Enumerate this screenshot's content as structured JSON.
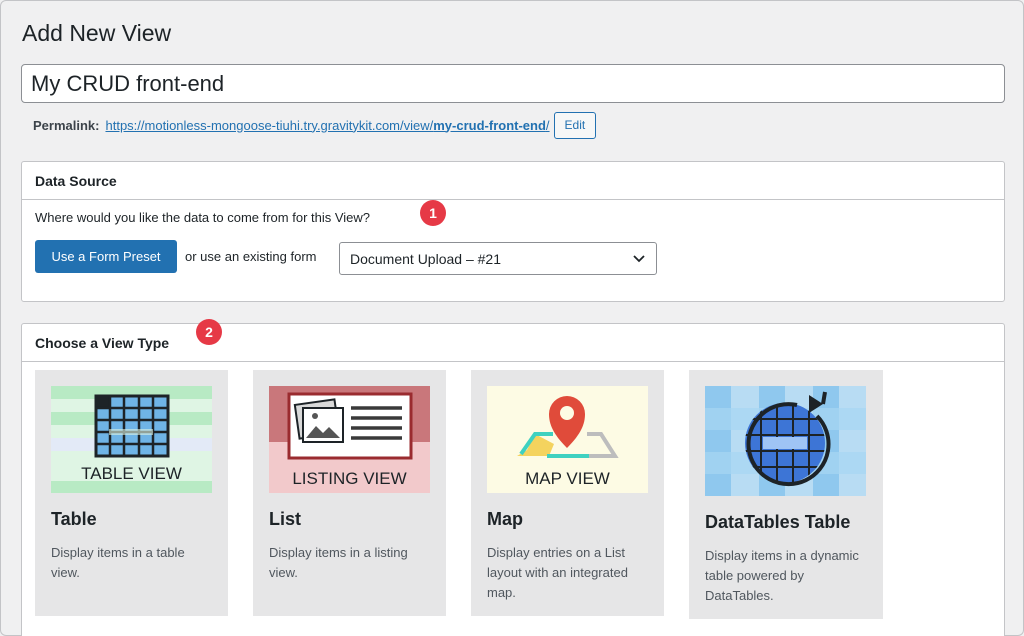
{
  "header": {
    "title": "Add New View"
  },
  "view_title": {
    "value": "My CRUD front-end"
  },
  "permalink": {
    "label": "Permalink:",
    "url_base": "https://motionless-mongoose-tiuhi.try.gravitykit.com/view/",
    "url_slug": "my-crud-front-end",
    "url_trail": "/",
    "edit_label": "Edit"
  },
  "data_source": {
    "heading": "Data Source",
    "question": "Where would you like the data to come from for this View?",
    "badge": "1",
    "preset_button": "Use a Form Preset",
    "or_text": "or use an existing form",
    "selected_form": "Document Upload – #21"
  },
  "view_type": {
    "heading": "Choose a View Type",
    "badge": "2",
    "cards": [
      {
        "image_caption": "TABLE VIEW",
        "title": "Table",
        "description": "Display items in a table view.",
        "icon": "table-icon"
      },
      {
        "image_caption": "LISTING VIEW",
        "title": "List",
        "description": "Display items in a listing view.",
        "icon": "listing-icon"
      },
      {
        "image_caption": "MAP VIEW",
        "title": "Map",
        "description": "Display entries on a List layout with an integrated map.",
        "icon": "map-pin-icon"
      },
      {
        "image_caption": "",
        "title": "DataTables Table",
        "description": "Display items in a dynamic table powered by DataTables.",
        "icon": "datatables-globe-icon"
      }
    ]
  },
  "colors": {
    "accent": "#2271b1",
    "badge": "#e63946",
    "page_bg": "#f0f0f1"
  }
}
